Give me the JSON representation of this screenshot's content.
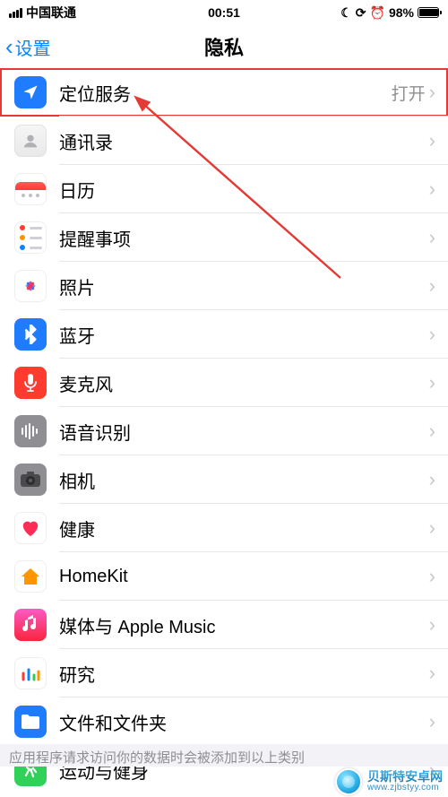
{
  "status": {
    "carrier": "中国联通",
    "time": "00:51",
    "battery_pct": "98%"
  },
  "nav": {
    "back_label": "设置",
    "title": "隐私"
  },
  "rows": {
    "location": {
      "label": "定位服务",
      "value": "打开"
    },
    "contacts": {
      "label": "通讯录"
    },
    "calendar": {
      "label": "日历"
    },
    "reminders": {
      "label": "提醒事项"
    },
    "photos": {
      "label": "照片"
    },
    "bluetooth": {
      "label": "蓝牙"
    },
    "microphone": {
      "label": "麦克风"
    },
    "speech": {
      "label": "语音识别"
    },
    "camera": {
      "label": "相机"
    },
    "health": {
      "label": "健康"
    },
    "homekit": {
      "label": "HomeKit"
    },
    "media": {
      "label": "媒体与 Apple Music"
    },
    "research": {
      "label": "研究"
    },
    "files": {
      "label": "文件和文件夹"
    },
    "fitness": {
      "label": "运动与健身"
    }
  },
  "footer_note": "应用程序请求访问你的数据时会被添加到以上类别",
  "watermark": {
    "name": "贝斯特安卓网",
    "url": "www.zjbstyy.com"
  },
  "annotation": {
    "highlight_row": "location"
  }
}
